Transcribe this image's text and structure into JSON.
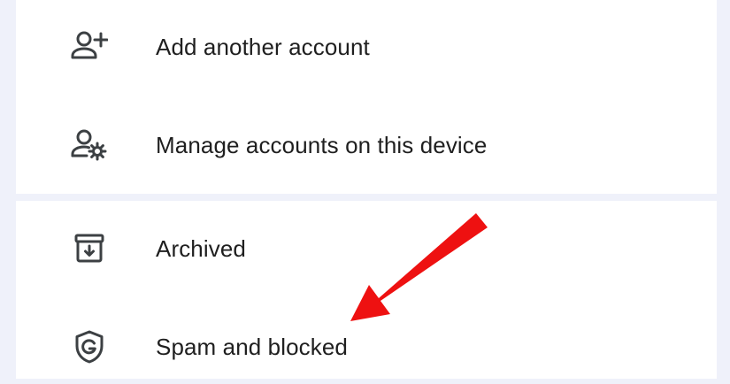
{
  "menu": {
    "account_section": [
      {
        "label": "Add another account",
        "icon": "person-add-icon"
      },
      {
        "label": "Manage accounts on this device",
        "icon": "manage-accounts-icon"
      }
    ],
    "folder_section": [
      {
        "label": "Archived",
        "icon": "archive-icon"
      },
      {
        "label": "Spam and blocked",
        "icon": "shield-icon"
      }
    ]
  },
  "annotation": {
    "arrow_color": "#ee1111"
  },
  "colors": {
    "background": "#eff1fa",
    "card": "#ffffff",
    "text": "#1f1f1f",
    "icon": "#3c4043"
  }
}
